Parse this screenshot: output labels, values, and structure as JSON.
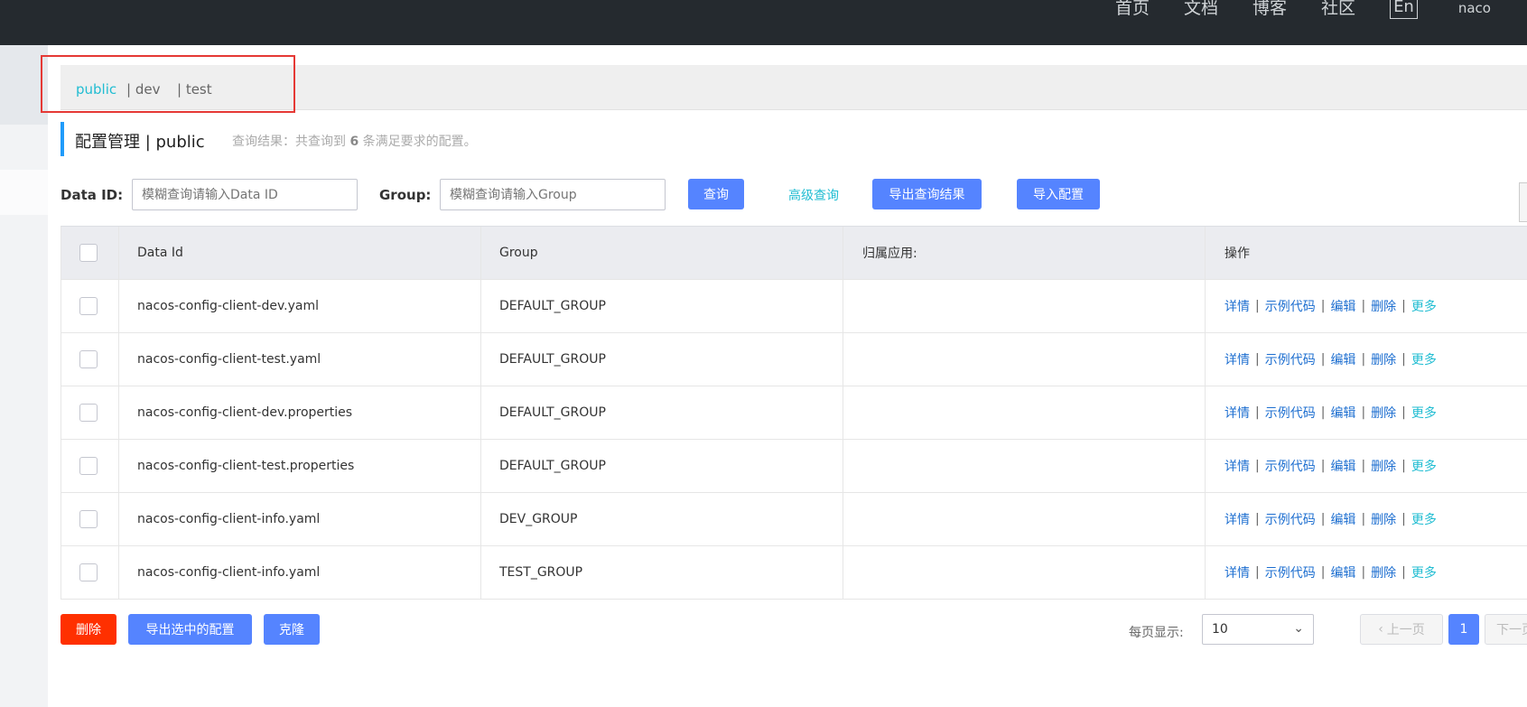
{
  "topnav": {
    "items": [
      "首页",
      "文档",
      "博客",
      "社区"
    ],
    "lang": "En",
    "user": "naco"
  },
  "namespaces": [
    {
      "label": "public",
      "active": true
    },
    {
      "label": "| dev",
      "active": false
    },
    {
      "label": "| test",
      "active": false
    }
  ],
  "header": {
    "title": "配置管理 | public",
    "result_prefix": "查询结果：共查询到",
    "result_count": "6",
    "result_suffix": "条满足要求的配置。"
  },
  "search": {
    "dataid_label": "Data ID:",
    "dataid_placeholder": "模糊查询请输入Data ID",
    "group_label": "Group:",
    "group_placeholder": "模糊查询请输入Group",
    "query_button": "查询",
    "advanced_link": "高级查询",
    "export_button": "导出查询结果",
    "import_button": "导入配置"
  },
  "table": {
    "columns": [
      "Data Id",
      "Group",
      "归属应用:",
      "操作"
    ],
    "rows": [
      {
        "data_id": "nacos-config-client-dev.yaml",
        "group": "DEFAULT_GROUP",
        "app": ""
      },
      {
        "data_id": "nacos-config-client-test.yaml",
        "group": "DEFAULT_GROUP",
        "app": ""
      },
      {
        "data_id": "nacos-config-client-dev.properties",
        "group": "DEFAULT_GROUP",
        "app": ""
      },
      {
        "data_id": "nacos-config-client-test.properties",
        "group": "DEFAULT_GROUP",
        "app": ""
      },
      {
        "data_id": "nacos-config-client-info.yaml",
        "group": "DEV_GROUP",
        "app": ""
      },
      {
        "data_id": "nacos-config-client-info.yaml",
        "group": "TEST_GROUP",
        "app": ""
      }
    ],
    "ops": {
      "detail": "详情",
      "sample": "示例代码",
      "edit": "编辑",
      "delete": "删除",
      "more": "更多",
      "sep": "|"
    }
  },
  "footer": {
    "delete_button": "删除",
    "export_selected_button": "导出选中的配置",
    "clone_button": "克隆",
    "page_size_label": "每页显示:",
    "page_size_value": "10",
    "prev_label": "上一页",
    "current_page": "1",
    "next_label": "下一页"
  },
  "colors": {
    "primary": "#5584ff",
    "danger": "#ff3000",
    "link": "#1e6fd0",
    "teal": "#21bdd2",
    "topbar": "#252a2f",
    "highlight": "#e53935"
  }
}
